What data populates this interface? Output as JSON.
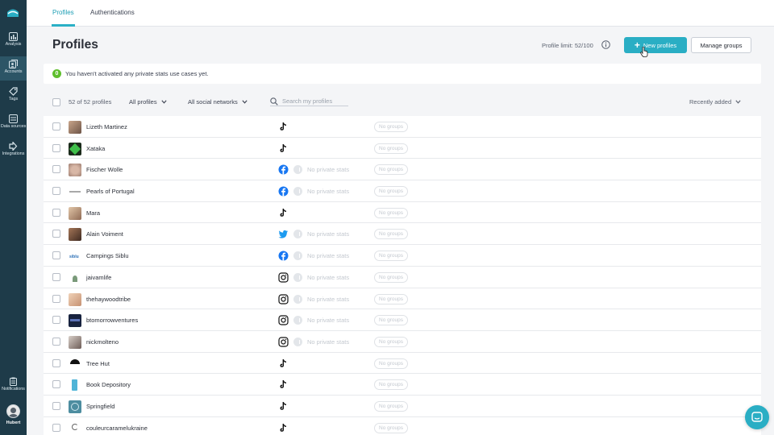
{
  "colors": {
    "sidebar": "#1e3b49",
    "accent": "#2aaec4",
    "success": "#5fbf2d"
  },
  "sidebar": {
    "logo": "logo-icon",
    "items": [
      {
        "label": "Analysis",
        "icon": "bar-chart-icon"
      },
      {
        "label": "Accounts",
        "icon": "accounts-icon",
        "active": true
      },
      {
        "label": "Tags",
        "icon": "tag-icon"
      },
      {
        "label": "Data sources",
        "icon": "database-icon"
      },
      {
        "label": "Integrations",
        "icon": "integrations-icon"
      },
      {
        "label": "Notifications",
        "icon": "clipboard-icon"
      }
    ],
    "user": {
      "name": "Hubert"
    }
  },
  "tabs": [
    {
      "label": "Profiles",
      "active": true
    },
    {
      "label": "Authentications",
      "active": false
    }
  ],
  "header": {
    "title": "Profiles",
    "limit": "Profile limit: 52/100",
    "new_button": "New profiles",
    "manage_button": "Manage groups"
  },
  "alert": {
    "badge": "0",
    "text": "You haven't activated any private stats use cases yet."
  },
  "filters": {
    "count": "52 of 52 profiles",
    "profiles_dd": "All profiles",
    "networks_dd": "All social networks",
    "search_placeholder": "Search my profiles",
    "sort": "Recently added"
  },
  "rows": [
    {
      "name": "Lizeth Martinez",
      "network": "tiktok",
      "private": "",
      "groups": "No groups"
    },
    {
      "name": "Xataka",
      "network": "tiktok",
      "private": "",
      "groups": "No groups"
    },
    {
      "name": "Fischer Wolle",
      "network": "facebook",
      "private": "No private stats",
      "groups": "No groups"
    },
    {
      "name": "Pearls of Portugal",
      "network": "facebook",
      "private": "No private stats",
      "groups": "No groups"
    },
    {
      "name": "Mara",
      "network": "tiktok",
      "private": "",
      "groups": "No groups"
    },
    {
      "name": "Alain Voiment",
      "network": "twitter",
      "private": "No private stats",
      "groups": "No groups"
    },
    {
      "name": "Campings Siblu",
      "network": "facebook",
      "private": "No private stats",
      "groups": "No groups"
    },
    {
      "name": "jaivamlife",
      "network": "instagram",
      "private": "No private stats",
      "groups": "No groups"
    },
    {
      "name": "thehaywoodtribe",
      "network": "instagram",
      "private": "No private stats",
      "groups": "No groups"
    },
    {
      "name": "btomorrowventures",
      "network": "instagram",
      "private": "No private stats",
      "groups": "No groups"
    },
    {
      "name": "nickmolteno",
      "network": "instagram",
      "private": "No private stats",
      "groups": "No groups"
    },
    {
      "name": "Tree Hut",
      "network": "tiktok",
      "private": "",
      "groups": "No groups"
    },
    {
      "name": "Book Depository",
      "network": "tiktok",
      "private": "",
      "groups": "No groups"
    },
    {
      "name": "Springfield",
      "network": "tiktok",
      "private": "",
      "groups": "No groups"
    },
    {
      "name": "couleurcaramelukraine",
      "network": "tiktok",
      "private": "",
      "groups": "No groups"
    }
  ]
}
